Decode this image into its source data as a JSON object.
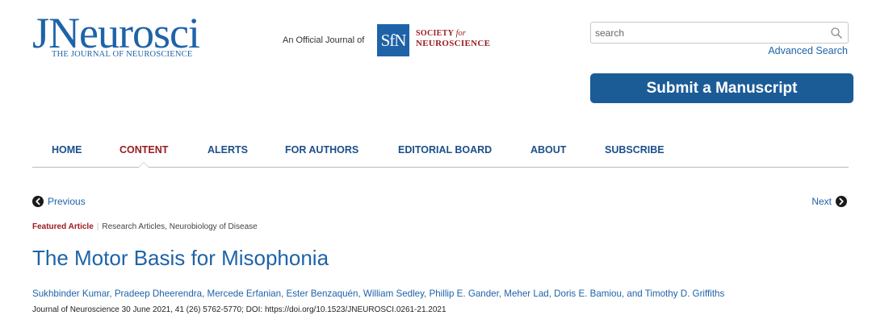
{
  "header": {
    "logo_big": "JNeurosci",
    "logo_sub": "THE JOURNAL OF NEUROSCIENCE",
    "official_text": "An Official Journal of",
    "sfn_logo_text": "SfN",
    "sfn_line1_a": "SOCIETY",
    "sfn_line1_b": "for",
    "sfn_line2": "NEUROSCIENCE",
    "search_placeholder": "search",
    "search_icon": "search-icon",
    "advanced_search": "Advanced Search",
    "submit_label": "Submit a Manuscript"
  },
  "nav": {
    "items": [
      {
        "label": "HOME"
      },
      {
        "label": "CONTENT"
      },
      {
        "label": "ALERTS"
      },
      {
        "label": "FOR AUTHORS"
      },
      {
        "label": "EDITORIAL BOARD"
      },
      {
        "label": "ABOUT"
      },
      {
        "label": "SUBSCRIBE"
      }
    ],
    "active": "CONTENT"
  },
  "article": {
    "prev_label": "Previous",
    "next_label": "Next",
    "featured_label": "Featured Article",
    "categories": "Research Articles, Neurobiology of Disease",
    "title": "The Motor Basis for Misophonia",
    "authors": "Sukhbinder Kumar, Pradeep Dheerendra, Mercede Erfanian, Ester Benzaquén, William Sedley, Phillip E. Gander, Meher Lad, Doris E. Bamiou, and Timothy D. Griffiths",
    "citation": "Journal of Neuroscience 30 June 2021, 41 (26) 5762-5770; DOI: https://doi.org/10.1523/JNEUROSCI.0261-21.2021"
  },
  "colors": {
    "brand_blue": "#1e63a8",
    "button_blue": "#1b5c97",
    "accent_red": "#9b1c20"
  }
}
